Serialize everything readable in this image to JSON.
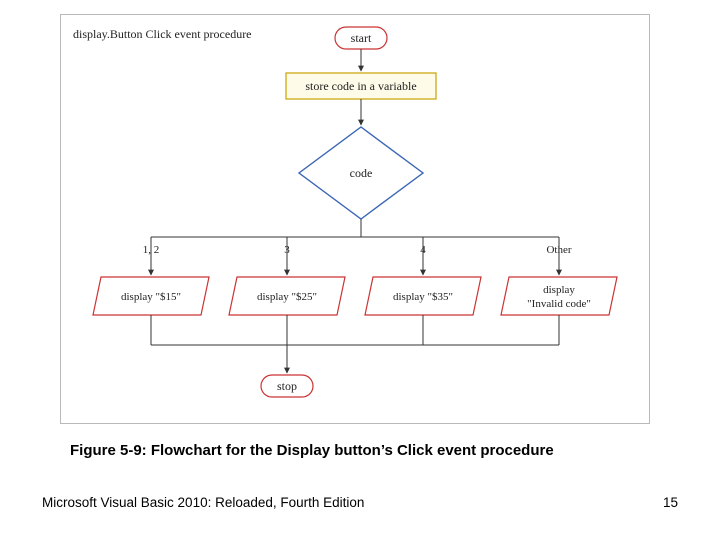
{
  "header": {
    "title": "display.Button Click event procedure"
  },
  "nodes": {
    "start": "start",
    "store": "store code in a variable",
    "decision": "code",
    "stop": "stop"
  },
  "branches": [
    {
      "label": "1, 2",
      "text1": "display \"$15\"",
      "text2": ""
    },
    {
      "label": "3",
      "text1": "display \"$25\"",
      "text2": ""
    },
    {
      "label": "4",
      "text1": "display \"$35\"",
      "text2": ""
    },
    {
      "label": "Other",
      "text1": "display",
      "text2": "\"Invalid code\""
    }
  ],
  "caption": "Figure 5-9: Flowchart for the Display button’s Click event procedure",
  "footer": {
    "left": "Microsoft Visual Basic 2010: Reloaded, Fourth Edition",
    "right": "15"
  }
}
